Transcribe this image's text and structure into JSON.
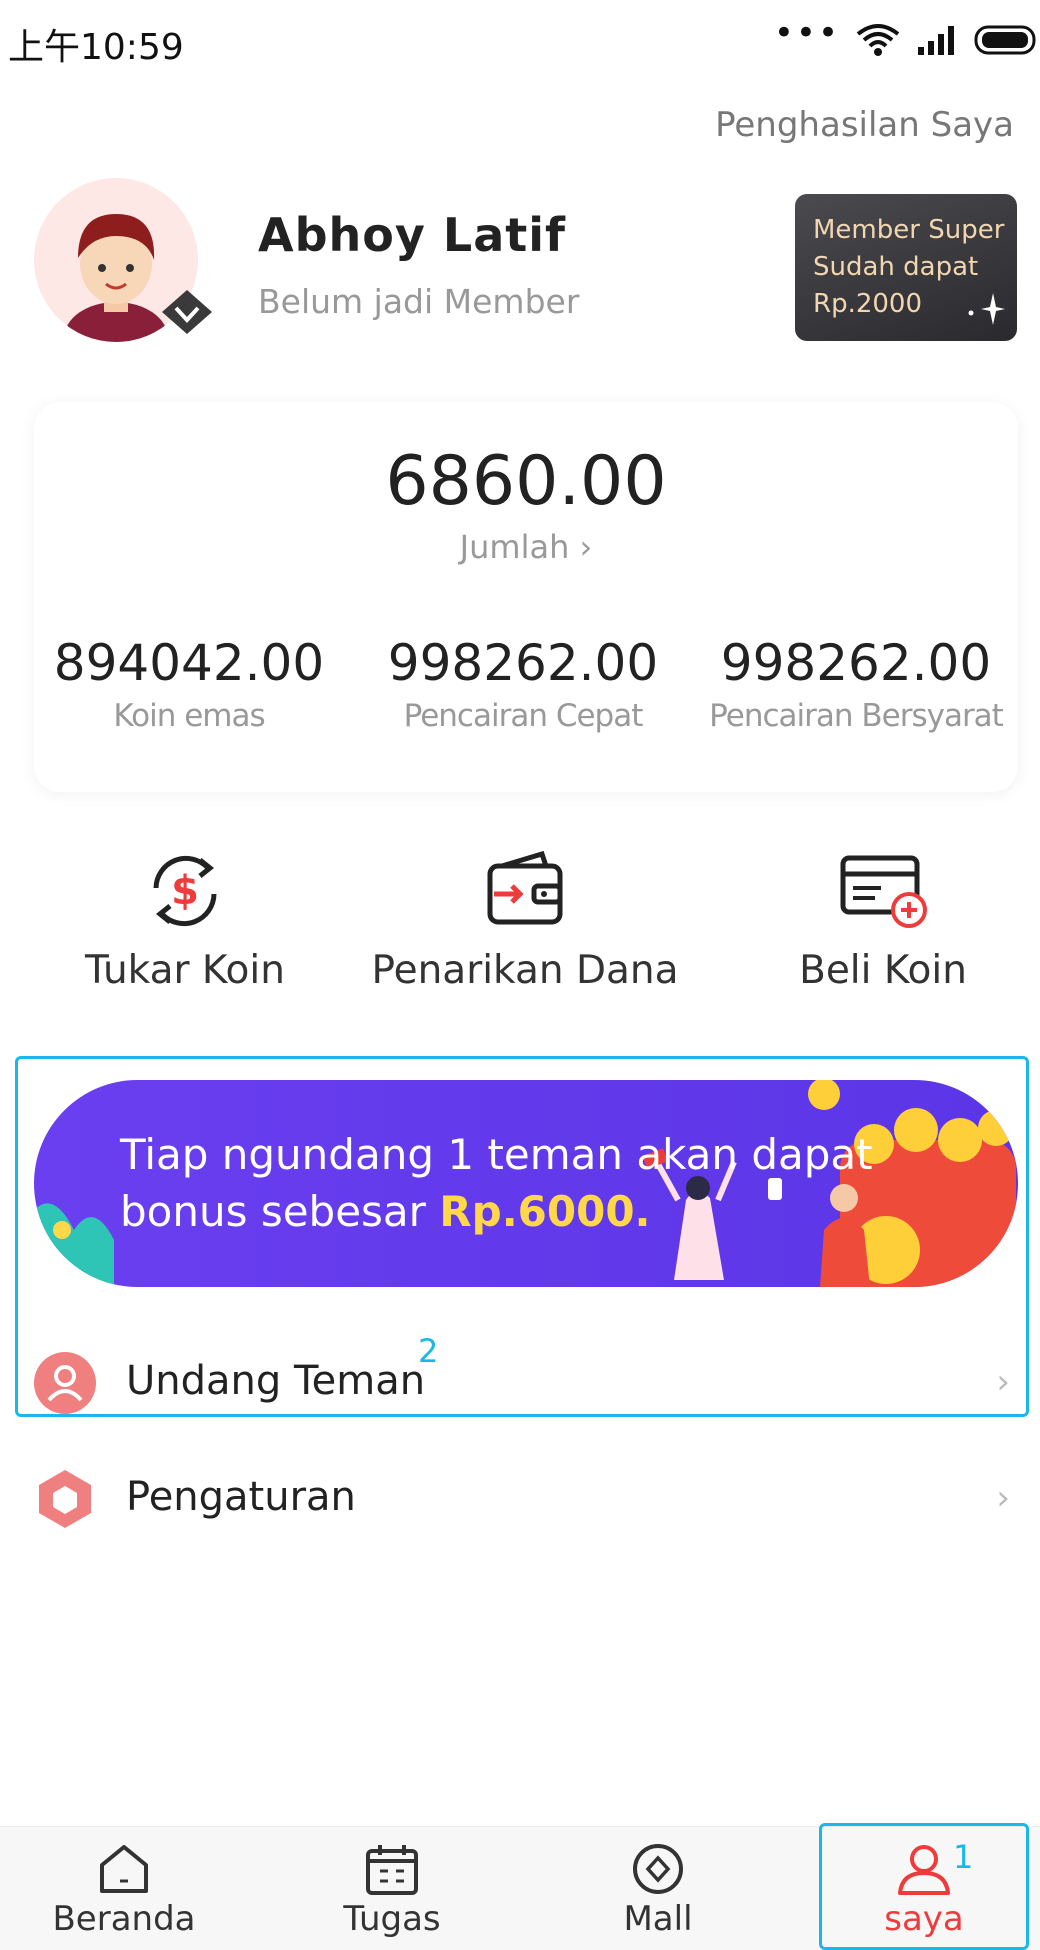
{
  "status_bar": {
    "time": "上午10:59",
    "dots": "•••"
  },
  "header": {
    "earnings_link": "Penghasilan Saya"
  },
  "profile": {
    "name": "Abhoy Latif",
    "member_status": "Belum jadi Member",
    "member_card": {
      "line1": "Member Super",
      "line2": "Sudah dapat",
      "line3": "Rp.2000"
    }
  },
  "balance": {
    "total_value": "6860.00",
    "total_label": "Jumlah ›",
    "stats": [
      {
        "value": "894042.00",
        "label": "Koin emas"
      },
      {
        "value": "998262.00",
        "label": "Pencairan Cepat"
      },
      {
        "value": "998262.00",
        "label": "Pencairan Bersyarat"
      }
    ]
  },
  "actions": [
    {
      "label": "Tukar Koin",
      "icon": "exchange-coin-icon"
    },
    {
      "label": "Penarikan Dana",
      "icon": "wallet-withdraw-icon"
    },
    {
      "label": "Beli Koin",
      "icon": "card-add-icon"
    }
  ],
  "banner": {
    "line1": "Tiap ngundang 1 teman akan dapat",
    "line2_prefix": "bonus sebesar ",
    "line2_amount": "Rp.6000."
  },
  "menu": [
    {
      "label": "Undang Teman",
      "icon": "user-icon",
      "chevron": "›"
    },
    {
      "label": "Pengaturan",
      "icon": "hexagon-settings-icon",
      "chevron": "›"
    }
  ],
  "annotations": {
    "box1": "1",
    "box2": "2"
  },
  "bottom_nav": [
    {
      "label": "Beranda",
      "icon": "home-icon"
    },
    {
      "label": "Tugas",
      "icon": "calendar-icon"
    },
    {
      "label": "Mall",
      "icon": "mall-icon"
    },
    {
      "label": "saya",
      "icon": "profile-icon",
      "active": true
    }
  ],
  "colors": {
    "accent_red": "#ef3b3b",
    "banner_purple": "#6a3ff0",
    "highlight_blue": "#1bb7ea",
    "pink_icon": "#f08080"
  }
}
